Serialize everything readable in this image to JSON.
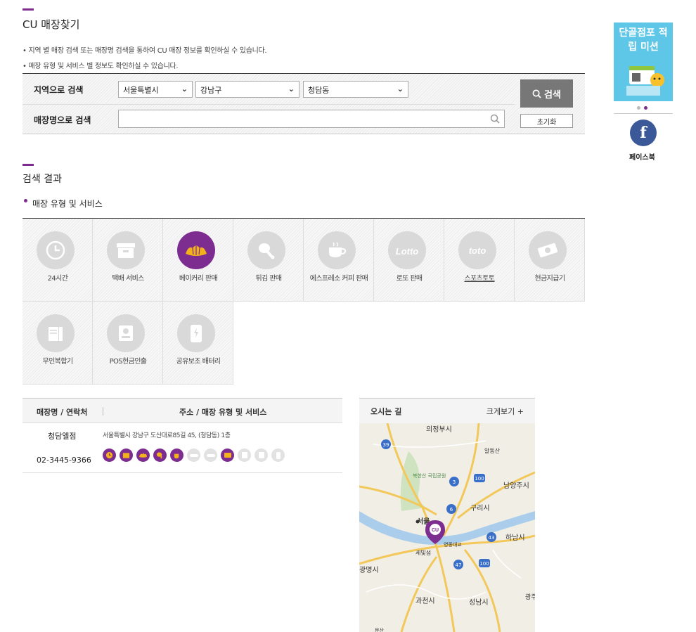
{
  "page_title": "CU 매장찾기",
  "notes": [
    "• 지역 별 매장 검색 또는 매장명 검색을 통하여 CU 매장 정보를 확인하실 수 있습니다.",
    "• 매장 유형 및 서비스 별 정보도 확인하실 수 있습니다."
  ],
  "search": {
    "region_label": "지역으로 검색",
    "name_label": "매장명으로 검색",
    "city": "서울특별시",
    "district": "강남구",
    "dong": "청담동",
    "name_value": "",
    "search_button": "검색",
    "reset_button": "초기화"
  },
  "results": {
    "title": "검색 결과",
    "services_title": "매장 유형 및 서비스",
    "services": [
      {
        "label": "24시간",
        "icon": "clock-icon",
        "active": false
      },
      {
        "label": "택배 서비스",
        "icon": "box-icon",
        "active": false
      },
      {
        "label": "베이커리 판매",
        "icon": "bread-icon",
        "active": true
      },
      {
        "label": "튀김 판매",
        "icon": "chicken-leg-icon",
        "active": false
      },
      {
        "label": "에스프레소 커피 판매",
        "icon": "coffee-cup-icon",
        "active": false
      },
      {
        "label": "로또 판매",
        "icon": "lotto-icon",
        "active": false
      },
      {
        "label": "스포츠토토",
        "icon": "toto-icon",
        "active": false
      },
      {
        "label": "현금지급기",
        "icon": "cash-icon",
        "active": false
      },
      {
        "label": "무인복합기",
        "icon": "kiosk-icon",
        "active": false
      },
      {
        "label": "POS현금인출",
        "icon": "pos-icon",
        "active": false
      },
      {
        "label": "공유보조 배터리",
        "icon": "battery-icon",
        "active": false
      }
    ],
    "table": {
      "col_store": "매장명 / 연락처",
      "col_address": "주소 / 매장 유형 및 서비스",
      "rows": [
        {
          "name": "청담엘점",
          "phone": "02-3445-9366",
          "address": "서울특별시 강남구 도산대로85길 45, (청담동) 1층",
          "service_flags": [
            true,
            true,
            true,
            true,
            true,
            false,
            false,
            true,
            false,
            false,
            false
          ]
        }
      ]
    },
    "map": {
      "title": "오시는 길",
      "enlarge": "크게보기 +",
      "places": [
        "의정부시",
        "알동산",
        "북한산 국립공원",
        "남양주시",
        "구리시",
        "서울",
        "영동대교",
        "세빛섬",
        "하남시",
        "광명시",
        "과천시",
        "성남시",
        "광주",
        "문산"
      ],
      "routes": [
        "39",
        "3",
        "100",
        "6",
        "43",
        "47",
        "100"
      ]
    }
  },
  "side": {
    "banner_title": "단골점포 적립 미션",
    "facebook_label": "페이스북"
  },
  "colors": {
    "accent": "#7d2c8f",
    "inactive_icon": "#d9d9d9",
    "facebook": "#3b5998"
  }
}
